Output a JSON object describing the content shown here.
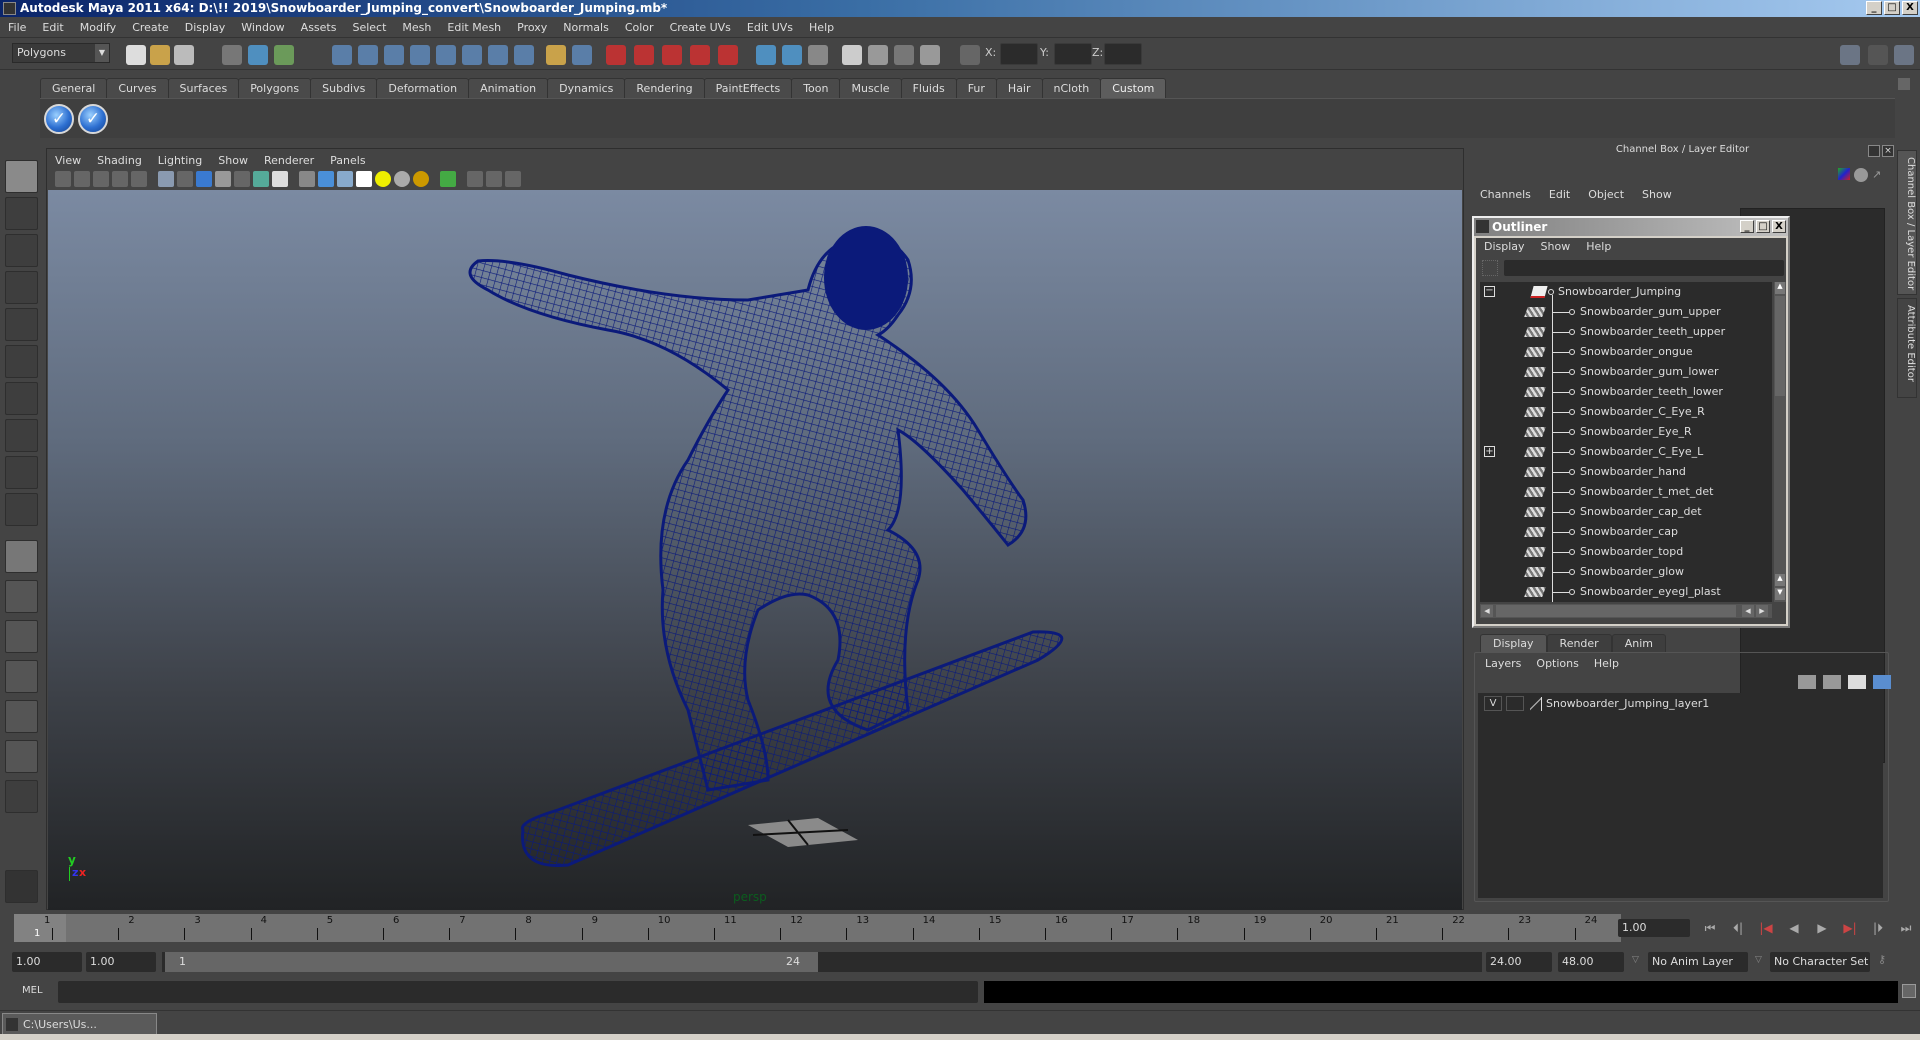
{
  "window": {
    "title": "Autodesk Maya 2011 x64: D:\\!! 2019\\Snowboarder_Jumping_convert\\Snowboarder_Jumping.mb*",
    "buttons": [
      "_",
      "□",
      "X"
    ]
  },
  "menubar": [
    "File",
    "Edit",
    "Modify",
    "Create",
    "Display",
    "Window",
    "Assets",
    "Select",
    "Mesh",
    "Edit Mesh",
    "Proxy",
    "Normals",
    "Color",
    "Create UVs",
    "Edit UVs",
    "Help"
  ],
  "statusline": {
    "menuset": "Polygons",
    "x_label": "X:",
    "y_label": "Y:",
    "z_label": "Z:"
  },
  "shelf": {
    "tabs": [
      "General",
      "Curves",
      "Surfaces",
      "Polygons",
      "Subdivs",
      "Deformation",
      "Animation",
      "Dynamics",
      "Rendering",
      "PaintEffects",
      "Toon",
      "Muscle",
      "Fluids",
      "Fur",
      "Hair",
      "nCloth",
      "Custom"
    ],
    "active_tab": "Custom",
    "icons": [
      "checkmark-icon",
      "checkmark-icon"
    ]
  },
  "toolbox": {
    "tools": [
      "select-tool",
      "lasso-tool",
      "paint-select-tool",
      "move-tool",
      "rotate-tool",
      "scale-tool",
      "universal-manipulator",
      "soft-modification-tool",
      "show-manipulator",
      "last-tool-used"
    ],
    "layouts": [
      "single-perspective",
      "four-view",
      "persp-outliner",
      "persp-graph",
      "hypershade-persp",
      "persp-graph-hypergraph"
    ]
  },
  "viewport": {
    "menu": [
      "View",
      "Shading",
      "Lighting",
      "Show",
      "Renderer",
      "Panels"
    ],
    "camera_label": "persp",
    "axis": {
      "y": "y",
      "z": "z",
      "x": "x"
    }
  },
  "channelbox": {
    "title": "Channel Box / Layer Editor",
    "menu": [
      "Channels",
      "Edit",
      "Object",
      "Show"
    ]
  },
  "outliner": {
    "title": "Outliner",
    "menu": [
      "Display",
      "Show",
      "Help"
    ],
    "root": "Snowboarder_Jumping",
    "items": [
      "Snowboarder_gum_upper",
      "Snowboarder_teeth_upper",
      "Snowboarder_ongue",
      "Snowboarder_gum_lower",
      "Snowboarder_teeth_lower",
      "Snowboarder_C_Eye_R",
      "Snowboarder_Eye_R",
      "Snowboarder_C_Eye_L",
      "Snowboarder_hand",
      "Snowboarder_t_met_det",
      "Snowboarder_cap_det",
      "Snowboarder_cap",
      "Snowboarder_topd",
      "Snowboarder_glow",
      "Snowboarder_eyegl_plast"
    ]
  },
  "layer_editor": {
    "tabs": [
      "Display",
      "Render",
      "Anim"
    ],
    "active_tab": "Display",
    "menu": [
      "Layers",
      "Options",
      "Help"
    ],
    "layers": [
      {
        "visible": "V",
        "name": "Snowboarder_Jumping_layer1"
      }
    ]
  },
  "side_tabs": [
    "Channel Box / Layer Editor",
    "Attribute Editor"
  ],
  "timeslider": {
    "ticks": [
      "1",
      "2",
      "3",
      "4",
      "5",
      "6",
      "7",
      "8",
      "9",
      "10",
      "11",
      "12",
      "13",
      "14",
      "15",
      "16",
      "17",
      "18",
      "19",
      "20",
      "21",
      "22",
      "23",
      "24"
    ],
    "current_frame_marker": "1",
    "current_time": "1.00",
    "playback_buttons": [
      "go-to-start",
      "step-back-frame",
      "step-back-key",
      "play-backward",
      "play-forward",
      "step-forward-key",
      "step-forward-frame",
      "go-to-end"
    ]
  },
  "rangeslider": {
    "start_time": "1.00",
    "playback_start": "1.00",
    "range_start_label": "1",
    "range_end_label": "24",
    "playback_end": "24.00",
    "end_time": "48.00",
    "anim_layer": "No Anim Layer",
    "character_set": "No Character Set"
  },
  "cmdline": {
    "label": "MEL"
  },
  "taskbar": {
    "item": "C:\\Users\\Us..."
  }
}
